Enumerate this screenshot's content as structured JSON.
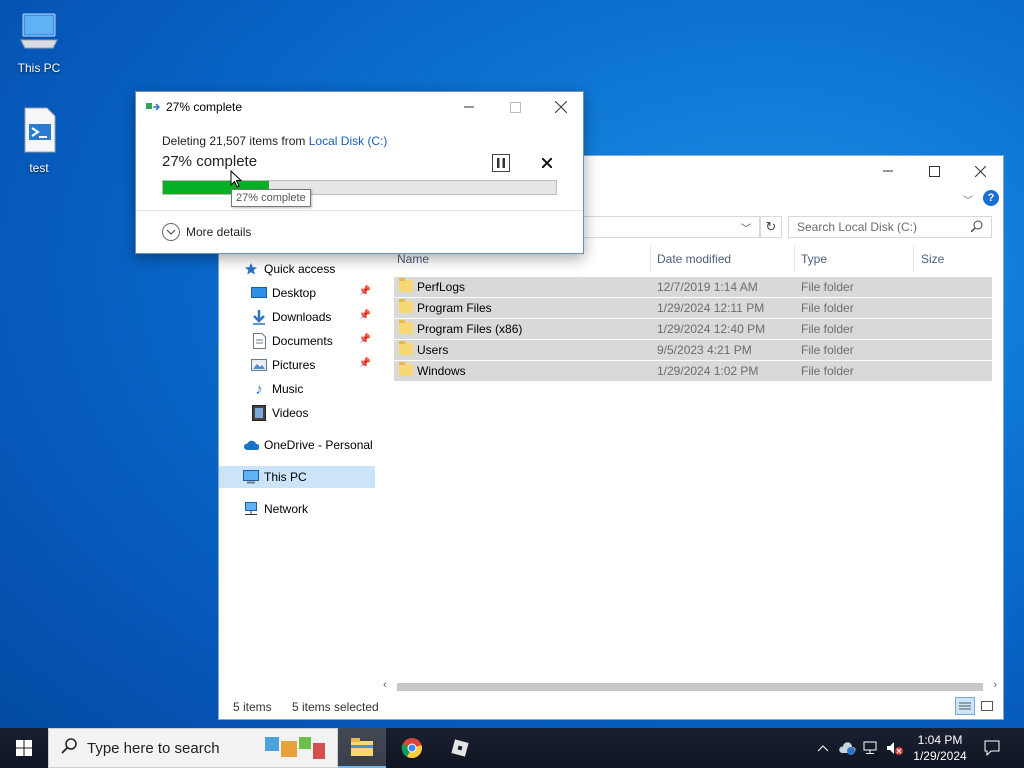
{
  "desktop": {
    "icons": [
      {
        "label": "This PC"
      },
      {
        "label": "test"
      }
    ]
  },
  "explorer": {
    "search_placeholder": "Search Local Disk (C:)",
    "nav": [
      {
        "label": "Quick access",
        "icon": "star-icon"
      },
      {
        "label": "Desktop",
        "icon": "desktop-folder-icon",
        "pinned": true
      },
      {
        "label": "Downloads",
        "icon": "download-icon",
        "pinned": true
      },
      {
        "label": "Documents",
        "icon": "documents-icon",
        "pinned": true
      },
      {
        "label": "Pictures",
        "icon": "pictures-icon",
        "pinned": true
      },
      {
        "label": "Music",
        "icon": "music-icon"
      },
      {
        "label": "Videos",
        "icon": "videos-icon"
      },
      {
        "label": "OneDrive - Personal",
        "icon": "onedrive-icon"
      },
      {
        "label": "This PC",
        "icon": "this-pc-icon",
        "selected": true
      },
      {
        "label": "Network",
        "icon": "network-icon"
      }
    ],
    "columns": {
      "name": "Name",
      "date": "Date modified",
      "type": "Type",
      "size": "Size"
    },
    "rows": [
      {
        "name": "PerfLogs",
        "date": "12/7/2019 1:14 AM",
        "type": "File folder"
      },
      {
        "name": "Program Files",
        "date": "1/29/2024 12:11 PM",
        "type": "File folder"
      },
      {
        "name": "Program Files (x86)",
        "date": "1/29/2024 12:40 PM",
        "type": "File folder"
      },
      {
        "name": "Users",
        "date": "9/5/2023 4:21 PM",
        "type": "File folder"
      },
      {
        "name": "Windows",
        "date": "1/29/2024 1:02 PM",
        "type": "File folder"
      }
    ],
    "status": {
      "count": "5 items",
      "selected": "5 items selected"
    }
  },
  "dialog": {
    "title": "27% complete",
    "desc_prefix": "Deleting 21,507 items from ",
    "desc_link": "Local Disk (C:)",
    "percent_text": "27% complete",
    "progress": 0.27,
    "more_details": "More details",
    "tooltip": "27% complete"
  },
  "taskbar": {
    "search_placeholder": "Type here to search",
    "time": "1:04 PM",
    "date": "1/29/2024"
  },
  "colors": {
    "progress_fill": "#06b025",
    "accent": "#0078d7",
    "selection": "#cce4f7"
  }
}
